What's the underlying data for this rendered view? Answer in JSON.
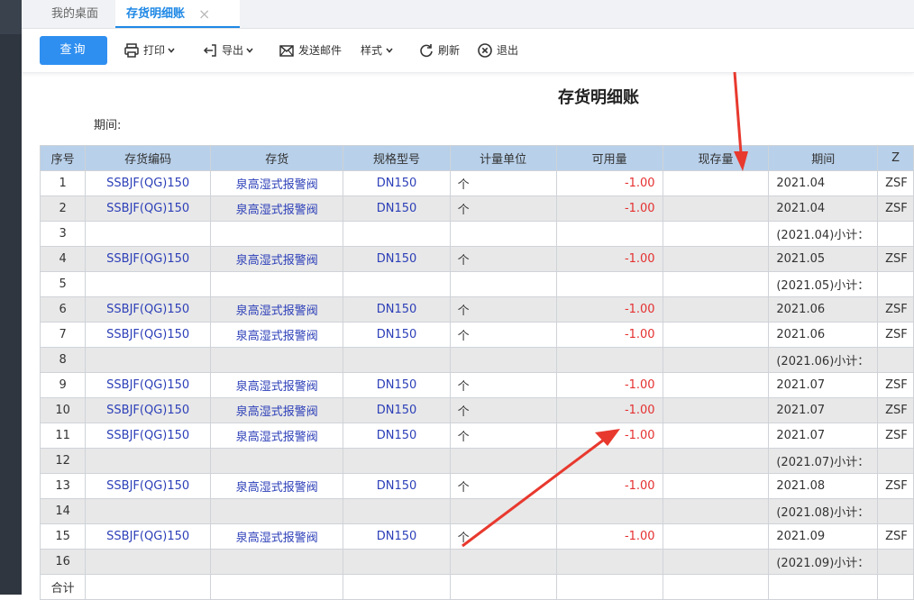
{
  "tabs": {
    "home": "我的桌面",
    "active": "存货明细账",
    "close": "×"
  },
  "toolbar": {
    "query": "查询",
    "print": "打印",
    "export": "导出",
    "email": "发送邮件",
    "style": "样式",
    "refresh": "刷新",
    "exit": "退出"
  },
  "report": {
    "title": "存货明细账",
    "period_label": "期间:"
  },
  "table": {
    "headers": [
      "序号",
      "存货编码",
      "存货",
      "规格型号",
      "计量单位",
      "可用量",
      "现存量",
      "期间",
      "Z"
    ],
    "rows": [
      {
        "idx": "1",
        "code": "SSBJF(QG)150",
        "name": "泉高湿式报警阀",
        "spec": "DN150",
        "unit": "个",
        "avail": "-1.00",
        "stock": "",
        "period": "2021.04",
        "extra": "ZSF",
        "alt": false
      },
      {
        "idx": "2",
        "code": "SSBJF(QG)150",
        "name": "泉高湿式报警阀",
        "spec": "DN150",
        "unit": "个",
        "avail": "-1.00",
        "stock": "",
        "period": "2021.04",
        "extra": "ZSF",
        "alt": true
      },
      {
        "idx": "3",
        "code": "",
        "name": "",
        "spec": "",
        "unit": "",
        "avail": "",
        "stock": "",
        "period": "(2021.04)小计：",
        "extra": "",
        "alt": false
      },
      {
        "idx": "4",
        "code": "SSBJF(QG)150",
        "name": "泉高湿式报警阀",
        "spec": "DN150",
        "unit": "个",
        "avail": "-1.00",
        "stock": "",
        "period": "2021.05",
        "extra": "ZSF",
        "alt": true
      },
      {
        "idx": "5",
        "code": "",
        "name": "",
        "spec": "",
        "unit": "",
        "avail": "",
        "stock": "",
        "period": "(2021.05)小计：",
        "extra": "",
        "alt": false
      },
      {
        "idx": "6",
        "code": "SSBJF(QG)150",
        "name": "泉高湿式报警阀",
        "spec": "DN150",
        "unit": "个",
        "avail": "-1.00",
        "stock": "",
        "period": "2021.06",
        "extra": "ZSF",
        "alt": true
      },
      {
        "idx": "7",
        "code": "SSBJF(QG)150",
        "name": "泉高湿式报警阀",
        "spec": "DN150",
        "unit": "个",
        "avail": "-1.00",
        "stock": "",
        "period": "2021.06",
        "extra": "ZSF",
        "alt": false
      },
      {
        "idx": "8",
        "code": "",
        "name": "",
        "spec": "",
        "unit": "",
        "avail": "",
        "stock": "",
        "period": "(2021.06)小计：",
        "extra": "",
        "alt": true
      },
      {
        "idx": "9",
        "code": "SSBJF(QG)150",
        "name": "泉高湿式报警阀",
        "spec": "DN150",
        "unit": "个",
        "avail": "-1.00",
        "stock": "",
        "period": "2021.07",
        "extra": "ZSF",
        "alt": false
      },
      {
        "idx": "10",
        "code": "SSBJF(QG)150",
        "name": "泉高湿式报警阀",
        "spec": "DN150",
        "unit": "个",
        "avail": "-1.00",
        "stock": "",
        "period": "2021.07",
        "extra": "ZSF",
        "alt": true
      },
      {
        "idx": "11",
        "code": "SSBJF(QG)150",
        "name": "泉高湿式报警阀",
        "spec": "DN150",
        "unit": "个",
        "avail": "-1.00",
        "stock": "",
        "period": "2021.07",
        "extra": "ZSF",
        "alt": false
      },
      {
        "idx": "12",
        "code": "",
        "name": "",
        "spec": "",
        "unit": "",
        "avail": "",
        "stock": "",
        "period": "(2021.07)小计：",
        "extra": "",
        "alt": true
      },
      {
        "idx": "13",
        "code": "SSBJF(QG)150",
        "name": "泉高湿式报警阀",
        "spec": "DN150",
        "unit": "个",
        "avail": "-1.00",
        "stock": "",
        "period": "2021.08",
        "extra": "ZSF",
        "alt": false
      },
      {
        "idx": "14",
        "code": "",
        "name": "",
        "spec": "",
        "unit": "",
        "avail": "",
        "stock": "",
        "period": "(2021.08)小计：",
        "extra": "",
        "alt": true
      },
      {
        "idx": "15",
        "code": "SSBJF(QG)150",
        "name": "泉高湿式报警阀",
        "spec": "DN150",
        "unit": "个",
        "avail": "-1.00",
        "stock": "",
        "period": "2021.09",
        "extra": "ZSF",
        "alt": false
      },
      {
        "idx": "16",
        "code": "",
        "name": "",
        "spec": "",
        "unit": "",
        "avail": "",
        "stock": "",
        "period": "(2021.09)小计：",
        "extra": "",
        "alt": true
      },
      {
        "idx": "合计",
        "code": "",
        "name": "",
        "spec": "",
        "unit": "",
        "avail": "",
        "stock": "",
        "period": "",
        "extra": "",
        "alt": false
      }
    ]
  },
  "colors": {
    "accent": "#2f8ff0",
    "header_bg": "#b8d0ea",
    "negative": "#e53030",
    "link": "#2c3fb8",
    "annotation": "#e8392e"
  }
}
